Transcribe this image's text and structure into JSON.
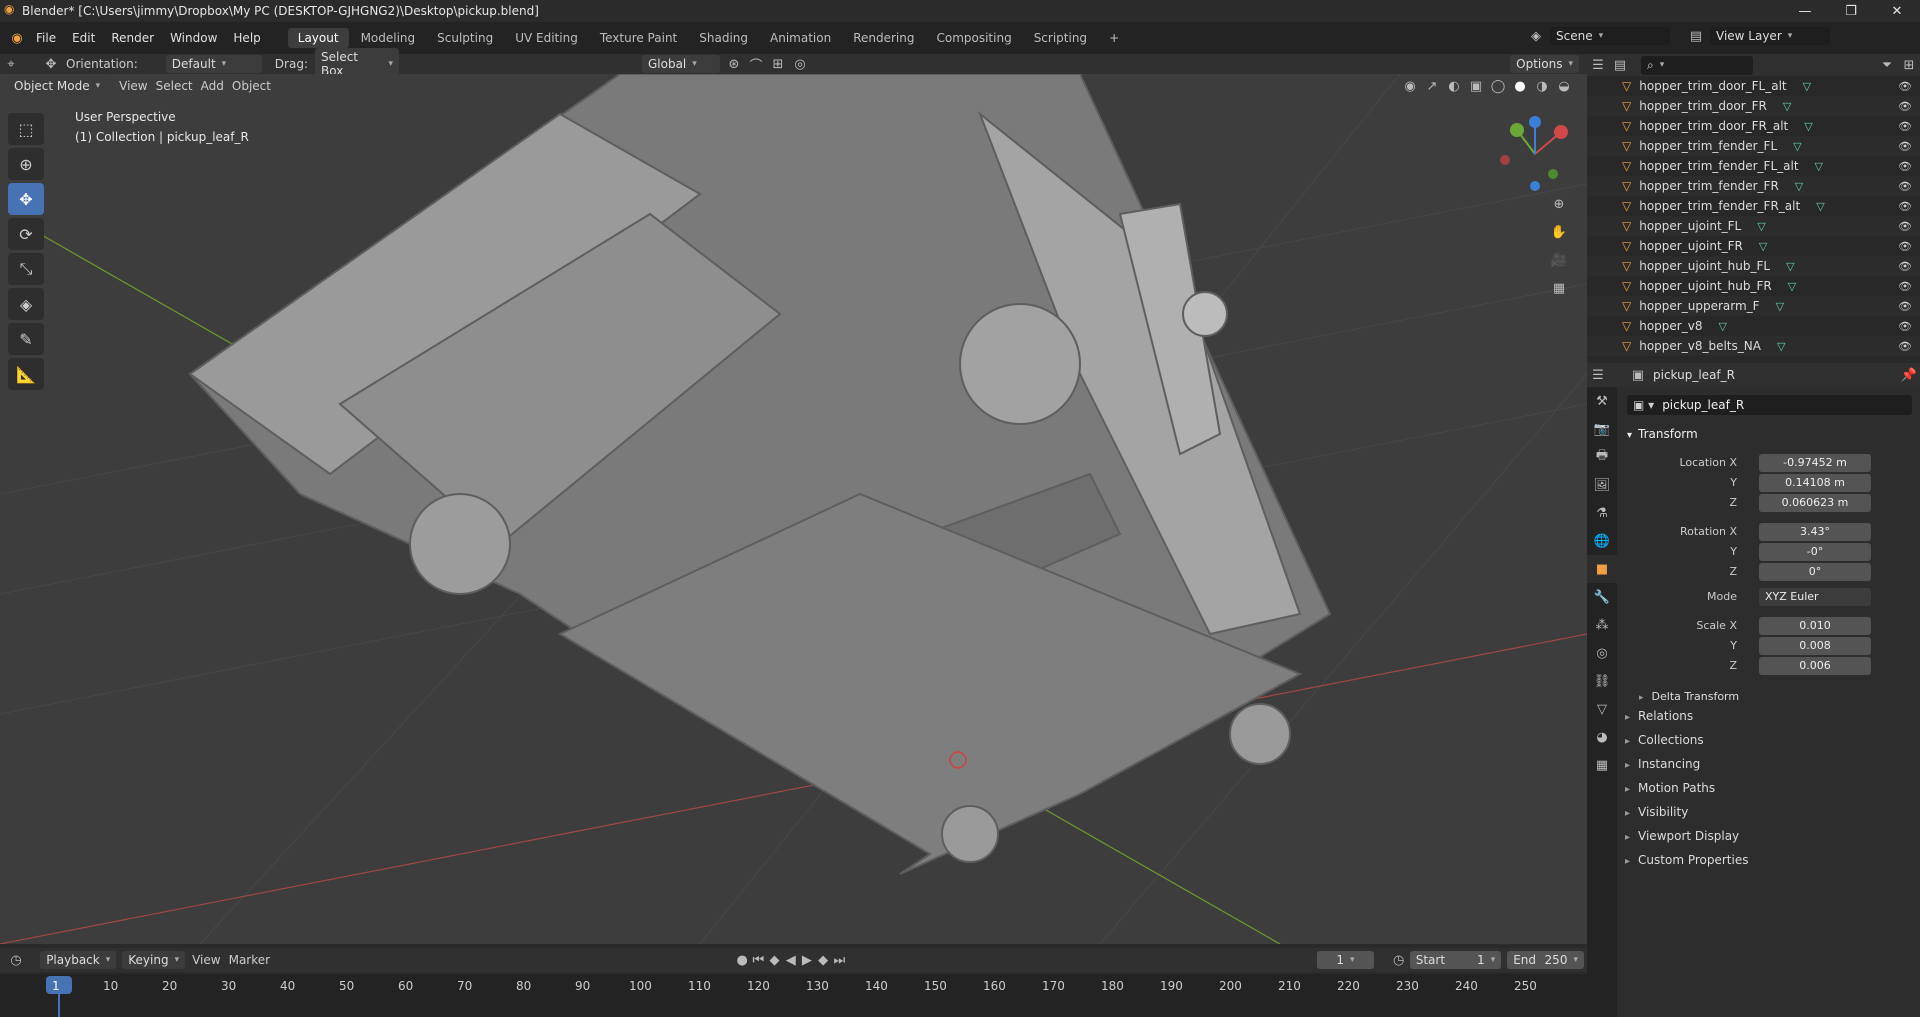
{
  "window": {
    "title": "Blender* [C:\\Users\\jimmy\\Dropbox\\My PC (DESKTOP-GJHGNG2)\\Desktop\\pickup.blend]"
  },
  "menu": [
    "File",
    "Edit",
    "Render",
    "Window",
    "Help"
  ],
  "workspaces": [
    "Layout",
    "Modeling",
    "Sculpting",
    "UV Editing",
    "Texture Paint",
    "Shading",
    "Animation",
    "Rendering",
    "Compositing",
    "Scripting"
  ],
  "active_workspace": "Layout",
  "scene": {
    "name": "Scene",
    "view_layer": "View Layer"
  },
  "tool_header": {
    "orientation_label": "Orientation:",
    "orientation_value": "Default",
    "drag_label": "Drag:",
    "drag_value": "Select Box",
    "transform_orientation": "Global",
    "options": "Options"
  },
  "viewport_header": {
    "mode": "Object Mode",
    "menus": [
      "View",
      "Select",
      "Add",
      "Object"
    ]
  },
  "viewport": {
    "perspective": "User Perspective",
    "collection_info": "(1) Collection | pickup_leaf_R"
  },
  "outliner": {
    "items": [
      "hopper_trim_door_FL_alt",
      "hopper_trim_door_FR",
      "hopper_trim_door_FR_alt",
      "hopper_trim_fender_FL",
      "hopper_trim_fender_FL_alt",
      "hopper_trim_fender_FR",
      "hopper_trim_fender_FR_alt",
      "hopper_ujoint_FL",
      "hopper_ujoint_FR",
      "hopper_ujoint_hub_FL",
      "hopper_ujoint_hub_FR",
      "hopper_upperarm_F",
      "hopper_v8",
      "hopper_v8_belts_NA"
    ]
  },
  "properties": {
    "object_name": "pickup_leaf_R",
    "object_field": "pickup_leaf_R",
    "transform_title": "Transform",
    "location": {
      "label_x": "Location X",
      "x": "-0.97452 m",
      "y": "0.14108 m",
      "z": "0.060623 m"
    },
    "rotation": {
      "label_x": "Rotation X",
      "x": "3.43°",
      "y": "-0°",
      "z": "0°"
    },
    "mode_label": "Mode",
    "mode": "XYZ Euler",
    "scale": {
      "label_x": "Scale X",
      "x": "0.010",
      "y": "0.008",
      "z": "0.006"
    },
    "axis_y": "Y",
    "axis_z": "Z",
    "delta": "Delta Transform",
    "sections": [
      "Relations",
      "Collections",
      "Instancing",
      "Motion Paths",
      "Visibility",
      "Viewport Display",
      "Custom Properties"
    ]
  },
  "timeline": {
    "menus": [
      "Playback",
      "Keying",
      "View",
      "Marker"
    ],
    "current_frame": "1",
    "start_label": "Start",
    "start": "1",
    "end_label": "End",
    "end": "250",
    "ticks": [
      "1",
      "10",
      "20",
      "30",
      "40",
      "50",
      "60",
      "70",
      "80",
      "90",
      "100",
      "110",
      "120",
      "130",
      "140",
      "150",
      "160",
      "170",
      "180",
      "190",
      "200",
      "210",
      "220",
      "230",
      "240",
      "250"
    ]
  },
  "colors": {
    "accent": "#4772b3",
    "object_orange": "#f0a040",
    "mesh_green": "#66d0a0"
  }
}
